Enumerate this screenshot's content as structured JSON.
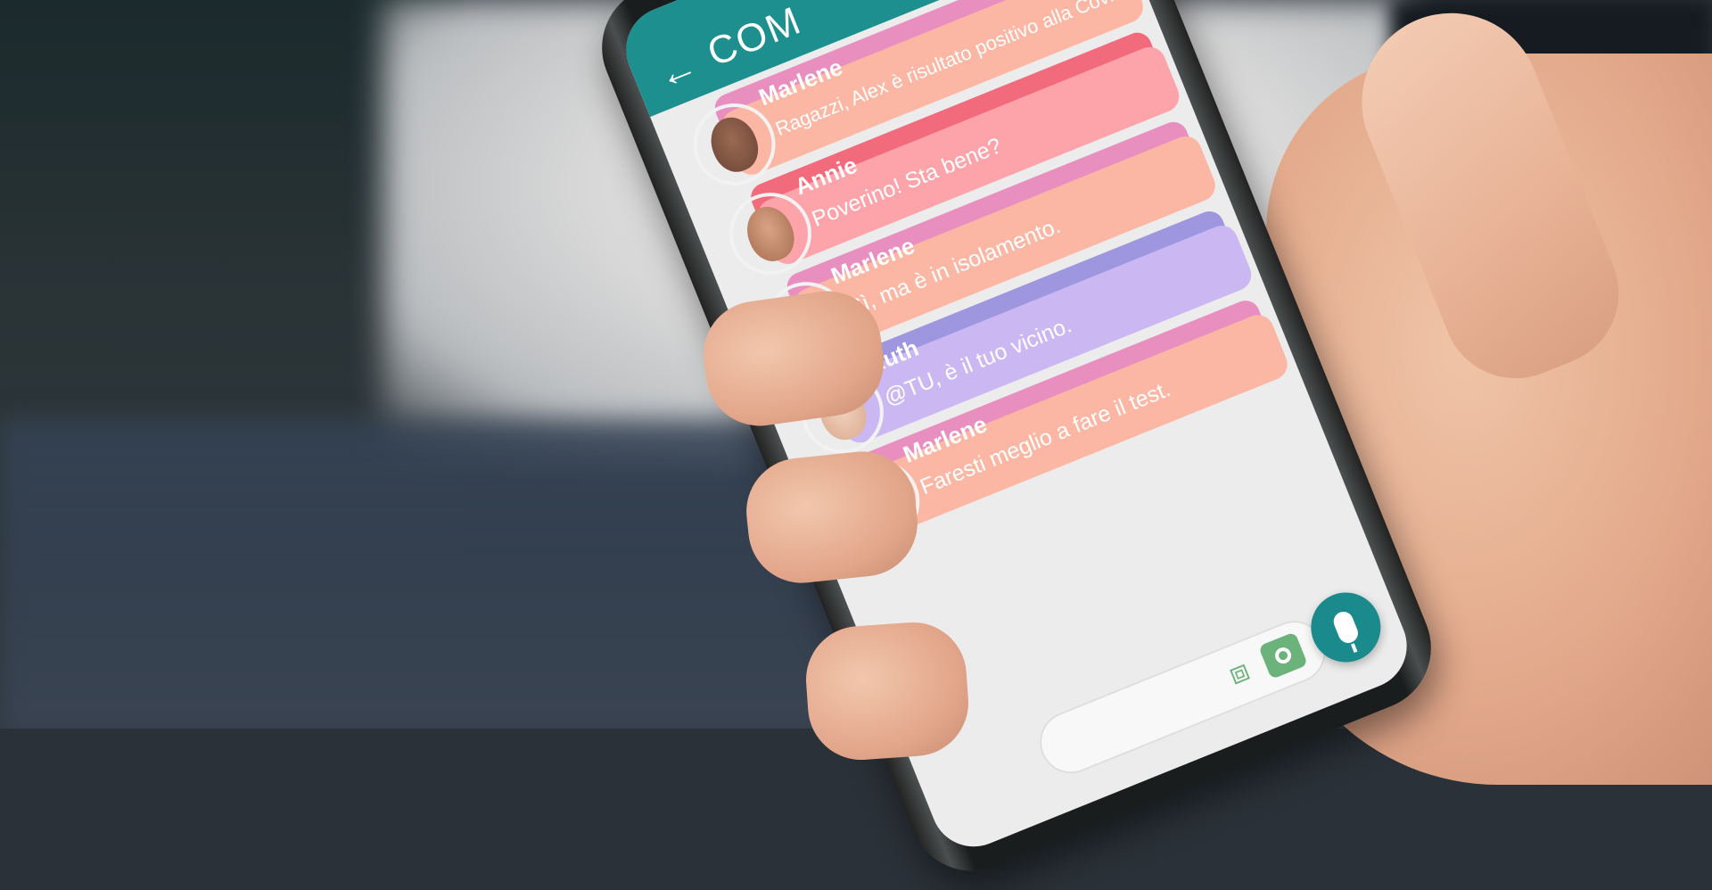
{
  "header": {
    "title": "COM",
    "back_icon": "arrow-left-icon"
  },
  "messages": [
    {
      "sender": "Marlene",
      "text": "Ragazzi, Alex è risultato positivo alla Covid.",
      "tab_color": "#e88fc0",
      "body_color": "#fbb7a3"
    },
    {
      "sender": "Annie",
      "text": "Poverino! Sta bene?",
      "tab_color": "#f26b7d",
      "body_color": "#fda3aa"
    },
    {
      "sender": "Marlene",
      "text": "Sì, ma è in isolamento.",
      "tab_color": "#e88fc0",
      "body_color": "#fbb7a3"
    },
    {
      "sender": "Ruth",
      "text": "@TU, è il tuo vicino.",
      "tab_color": "#9e97e0",
      "body_color": "#cbb8f2"
    },
    {
      "sender": "Marlene",
      "text": "Faresti meglio a fare il test.",
      "tab_color": "#e88fc0",
      "body_color": "#fbb7a3"
    }
  ],
  "composer": {
    "attach_icon": "paperclip-icon",
    "camera_icon": "camera-icon"
  },
  "mic_icon": "microphone-icon",
  "colors": {
    "header": "#1d8f8f",
    "mic_button": "#1a8a8c",
    "composer_icons": "#6bb27b"
  }
}
